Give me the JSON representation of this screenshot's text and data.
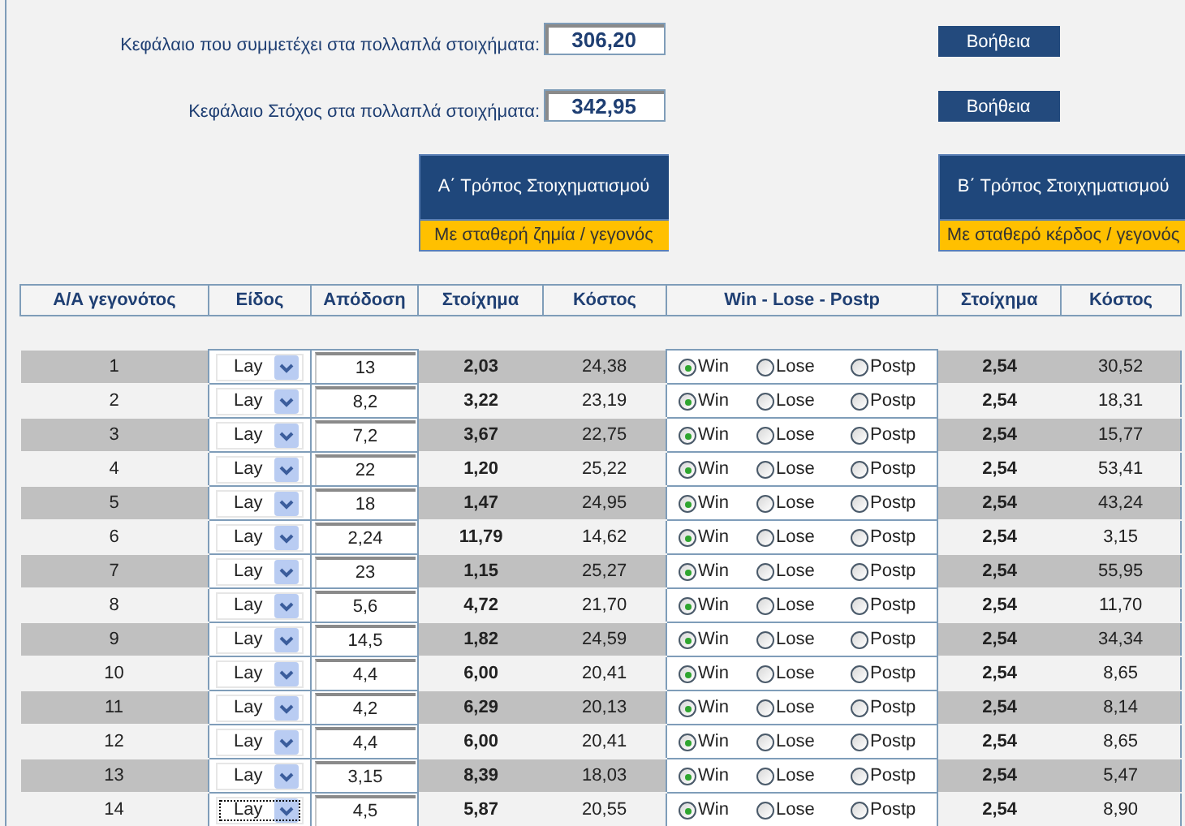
{
  "capital_fields": [
    {
      "label": "Κεφάλαιο που συμμετέχει στα πολλαπλά στοιχήματα:",
      "value": "306,20",
      "help_button": "Βοήθεια"
    },
    {
      "label": "Κεφάλαιο Στόχος στα πολλαπλά στοιχήματα:",
      "value": "342,95",
      "help_button": "Βοήθεια"
    }
  ],
  "modes": [
    {
      "title": "Α΄ Τρόπος Στοιχηματισμού",
      "subtitle": "Με σταθερή ζημία / γεγονός"
    },
    {
      "title": "Β΄ Τρόπος Στοιχηματισμού",
      "subtitle": "Με σταθερό κέρδος / γεγονός"
    }
  ],
  "table": {
    "columns": [
      "Α/Α γεγονότος",
      "Είδος",
      "Απόδοση",
      "Στοίχημα",
      "Κόστος",
      "Win - Lose - Postp",
      "Στοίχημα",
      "Κόστος"
    ],
    "rows": [
      {
        "index": "1",
        "type": "Lay",
        "focused": false,
        "odds": "13",
        "stake_a": "2,03",
        "cost_a": "24,38",
        "outcomes": [
          {
            "label": "Win",
            "selected": true
          },
          {
            "label": "Lose",
            "selected": false
          },
          {
            "label": "Postp",
            "selected": false
          }
        ],
        "stake_b": "2,54",
        "cost_b": "30,52"
      },
      {
        "index": "2",
        "type": "Lay",
        "focused": false,
        "odds": "8,2",
        "stake_a": "3,22",
        "cost_a": "23,19",
        "outcomes": [
          {
            "label": "Win",
            "selected": true
          },
          {
            "label": "Lose",
            "selected": false
          },
          {
            "label": "Postp",
            "selected": false
          }
        ],
        "stake_b": "2,54",
        "cost_b": "18,31"
      },
      {
        "index": "3",
        "type": "Lay",
        "focused": false,
        "odds": "7,2",
        "stake_a": "3,67",
        "cost_a": "22,75",
        "outcomes": [
          {
            "label": "Win",
            "selected": true
          },
          {
            "label": "Lose",
            "selected": false
          },
          {
            "label": "Postp",
            "selected": false
          }
        ],
        "stake_b": "2,54",
        "cost_b": "15,77"
      },
      {
        "index": "4",
        "type": "Lay",
        "focused": false,
        "odds": "22",
        "stake_a": "1,20",
        "cost_a": "25,22",
        "outcomes": [
          {
            "label": "Win",
            "selected": true
          },
          {
            "label": "Lose",
            "selected": false
          },
          {
            "label": "Postp",
            "selected": false
          }
        ],
        "stake_b": "2,54",
        "cost_b": "53,41"
      },
      {
        "index": "5",
        "type": "Lay",
        "focused": false,
        "odds": "18",
        "stake_a": "1,47",
        "cost_a": "24,95",
        "outcomes": [
          {
            "label": "Win",
            "selected": true
          },
          {
            "label": "Lose",
            "selected": false
          },
          {
            "label": "Postp",
            "selected": false
          }
        ],
        "stake_b": "2,54",
        "cost_b": "43,24"
      },
      {
        "index": "6",
        "type": "Lay",
        "focused": false,
        "odds": "2,24",
        "stake_a": "11,79",
        "cost_a": "14,62",
        "outcomes": [
          {
            "label": "Win",
            "selected": true
          },
          {
            "label": "Lose",
            "selected": false
          },
          {
            "label": "Postp",
            "selected": false
          }
        ],
        "stake_b": "2,54",
        "cost_b": "3,15"
      },
      {
        "index": "7",
        "type": "Lay",
        "focused": false,
        "odds": "23",
        "stake_a": "1,15",
        "cost_a": "25,27",
        "outcomes": [
          {
            "label": "Win",
            "selected": true
          },
          {
            "label": "Lose",
            "selected": false
          },
          {
            "label": "Postp",
            "selected": false
          }
        ],
        "stake_b": "2,54",
        "cost_b": "55,95"
      },
      {
        "index": "8",
        "type": "Lay",
        "focused": false,
        "odds": "5,6",
        "stake_a": "4,72",
        "cost_a": "21,70",
        "outcomes": [
          {
            "label": "Win",
            "selected": true
          },
          {
            "label": "Lose",
            "selected": false
          },
          {
            "label": "Postp",
            "selected": false
          }
        ],
        "stake_b": "2,54",
        "cost_b": "11,70"
      },
      {
        "index": "9",
        "type": "Lay",
        "focused": false,
        "odds": "14,5",
        "stake_a": "1,82",
        "cost_a": "24,59",
        "outcomes": [
          {
            "label": "Win",
            "selected": true
          },
          {
            "label": "Lose",
            "selected": false
          },
          {
            "label": "Postp",
            "selected": false
          }
        ],
        "stake_b": "2,54",
        "cost_b": "34,34"
      },
      {
        "index": "10",
        "type": "Lay",
        "focused": false,
        "odds": "4,4",
        "stake_a": "6,00",
        "cost_a": "20,41",
        "outcomes": [
          {
            "label": "Win",
            "selected": true
          },
          {
            "label": "Lose",
            "selected": false
          },
          {
            "label": "Postp",
            "selected": false
          }
        ],
        "stake_b": "2,54",
        "cost_b": "8,65"
      },
      {
        "index": "11",
        "type": "Lay",
        "focused": false,
        "odds": "4,2",
        "stake_a": "6,29",
        "cost_a": "20,13",
        "outcomes": [
          {
            "label": "Win",
            "selected": true
          },
          {
            "label": "Lose",
            "selected": false
          },
          {
            "label": "Postp",
            "selected": false
          }
        ],
        "stake_b": "2,54",
        "cost_b": "8,14"
      },
      {
        "index": "12",
        "type": "Lay",
        "focused": false,
        "odds": "4,4",
        "stake_a": "6,00",
        "cost_a": "20,41",
        "outcomes": [
          {
            "label": "Win",
            "selected": true
          },
          {
            "label": "Lose",
            "selected": false
          },
          {
            "label": "Postp",
            "selected": false
          }
        ],
        "stake_b": "2,54",
        "cost_b": "8,65"
      },
      {
        "index": "13",
        "type": "Lay",
        "focused": false,
        "odds": "3,15",
        "stake_a": "8,39",
        "cost_a": "18,03",
        "outcomes": [
          {
            "label": "Win",
            "selected": true
          },
          {
            "label": "Lose",
            "selected": false
          },
          {
            "label": "Postp",
            "selected": false
          }
        ],
        "stake_b": "2,54",
        "cost_b": "5,47"
      },
      {
        "index": "14",
        "type": "Lay",
        "focused": true,
        "odds": "4,5",
        "stake_a": "5,87",
        "cost_a": "20,55",
        "outcomes": [
          {
            "label": "Win",
            "selected": true
          },
          {
            "label": "Lose",
            "selected": false
          },
          {
            "label": "Postp",
            "selected": false
          }
        ],
        "stake_b": "2,54",
        "cost_b": "8,90"
      }
    ]
  }
}
